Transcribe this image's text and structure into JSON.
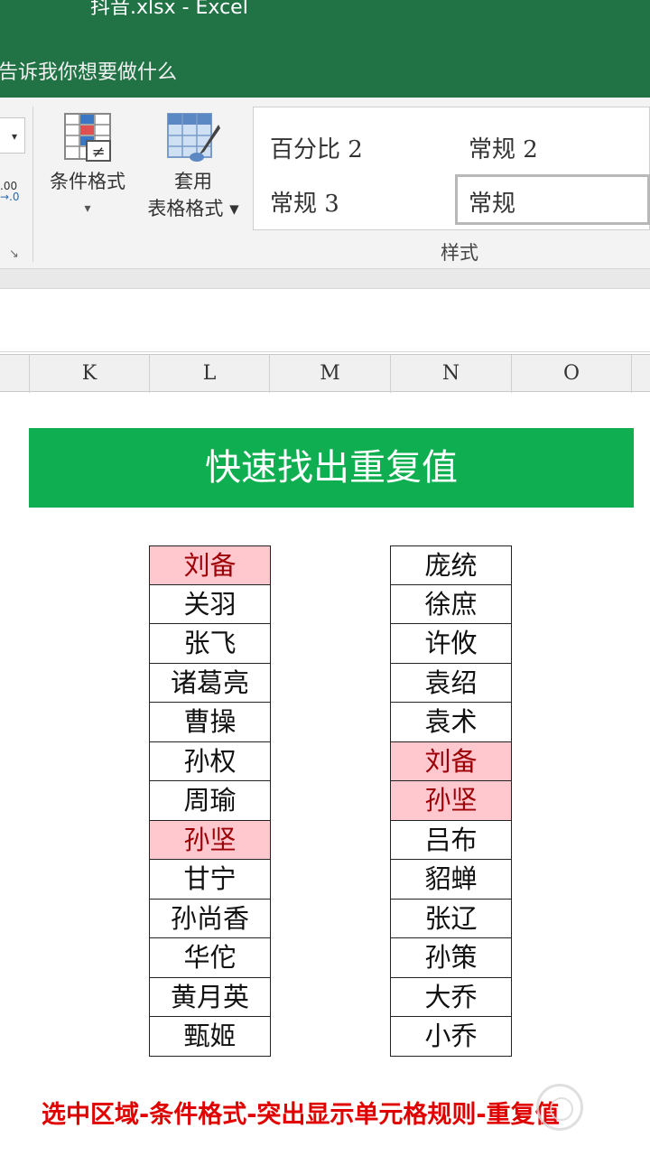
{
  "window": {
    "title": "抖音.xlsx  -  Excel",
    "tell_me": "告诉我你想要做什么"
  },
  "ribbon": {
    "conditional_format": {
      "line1": "条件格式",
      "line2": "▾"
    },
    "format_as_table": {
      "line1": "套用",
      "line2": "表格格式 ▾"
    },
    "number_format_hint": {
      "line1": ".00",
      "line2": "→.0"
    },
    "styles": {
      "percent2": "百分比 2",
      "normal2": "常规 2",
      "normal3": "常规 3",
      "normal": "常规"
    },
    "group_label": "样式"
  },
  "columns": [
    "K",
    "L",
    "M",
    "N",
    "O"
  ],
  "sheet": {
    "banner": "快速找出重复值",
    "list_left": [
      {
        "name": "刘备",
        "dup": true
      },
      {
        "name": "关羽",
        "dup": false
      },
      {
        "name": "张飞",
        "dup": false
      },
      {
        "name": "诸葛亮",
        "dup": false
      },
      {
        "name": "曹操",
        "dup": false
      },
      {
        "name": "孙权",
        "dup": false
      },
      {
        "name": "周瑜",
        "dup": false
      },
      {
        "name": "孙坚",
        "dup": true
      },
      {
        "name": "甘宁",
        "dup": false
      },
      {
        "name": "孙尚香",
        "dup": false
      },
      {
        "name": "华佗",
        "dup": false
      },
      {
        "name": "黄月英",
        "dup": false
      },
      {
        "name": "甄姬",
        "dup": false
      }
    ],
    "list_right": [
      {
        "name": "庞统",
        "dup": false
      },
      {
        "name": "徐庶",
        "dup": false
      },
      {
        "name": "许攸",
        "dup": false
      },
      {
        "name": "袁绍",
        "dup": false
      },
      {
        "name": "袁术",
        "dup": false
      },
      {
        "name": "刘备",
        "dup": true
      },
      {
        "name": "孙坚",
        "dup": true
      },
      {
        "name": "吕布",
        "dup": false
      },
      {
        "name": "貂蝉",
        "dup": false
      },
      {
        "name": "张辽",
        "dup": false
      },
      {
        "name": "孙策",
        "dup": false
      },
      {
        "name": "大乔",
        "dup": false
      },
      {
        "name": "小乔",
        "dup": false
      }
    ],
    "duplicate_fill": "#ffc7ce",
    "duplicate_text": "#9c0006"
  },
  "caption": "选中区域-条件格式-突出显示单元格规则-重复值",
  "colors": {
    "titlebar": "#217346",
    "banner": "#0fae50",
    "caption": "#e00000"
  }
}
